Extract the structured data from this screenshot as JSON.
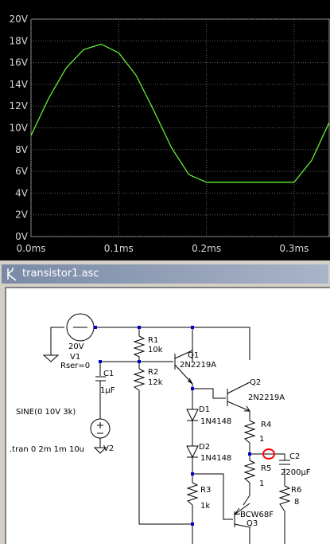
{
  "plot": {
    "y_ticks": [
      "0V",
      "2V",
      "4V",
      "6V",
      "8V",
      "10V",
      "12V",
      "14V",
      "16V",
      "18V",
      "20V"
    ],
    "x_ticks": [
      "0.0ms",
      "0.1ms",
      "0.2ms",
      "0.3ms"
    ],
    "trace_color": "#66ee33",
    "grid_color": "#606060",
    "background": "#000000"
  },
  "chart_data": {
    "type": "line",
    "x_unit": "ms",
    "y_unit": "V",
    "xlim": [
      0.0,
      0.34
    ],
    "ylim": [
      0,
      20
    ],
    "grid": true,
    "series": [
      {
        "x": [
          0.0,
          0.02,
          0.04,
          0.06,
          0.08,
          0.1,
          0.12,
          0.14,
          0.16,
          0.18,
          0.2,
          0.22,
          0.24,
          0.26,
          0.28,
          0.3,
          0.32,
          0.34
        ],
        "values": [
          9.3,
          12.7,
          15.5,
          17.2,
          17.7,
          16.9,
          14.8,
          11.6,
          8.2,
          5.7,
          5.0,
          5.0,
          5.0,
          5.0,
          5.0,
          5.0,
          7.0,
          10.5
        ]
      }
    ]
  },
  "window": {
    "title": "transistor1.asc"
  },
  "schematic": {
    "v1_value": "20V",
    "v1_name": "V1",
    "v1_rser": "Rser=0",
    "c1_name": "C1",
    "c1_value": "1µF",
    "sine_label": "SINE(0 10V 3k)",
    "tran_label": ".tran 0 2m 1m 10u",
    "v2_name": "V2",
    "r1_name": "R1",
    "r1_value": "10k",
    "r2_name": "R2",
    "r2_value": "12k",
    "q1_name": "Q1",
    "q1_model": "2N2219A",
    "q2_name": "Q2",
    "q2_model": "2N2219A",
    "d1_name": "D1",
    "d1_model": "1N4148",
    "d2_name": "D2",
    "d2_model": "1N4148",
    "r3_name": "R3",
    "r3_value": "1k",
    "r4_name": "R4",
    "r4_value": "1",
    "r5_name": "R5",
    "r5_value": "1",
    "c2_name": "C2",
    "c2_value": "2200µF",
    "r6_name": "R6",
    "r6_value": "8",
    "q3_model": "BCW68F",
    "q3_name": "Q3",
    "probe_color": "#ff0000",
    "wire_color": "#000000",
    "node_color": "#0000cc"
  }
}
